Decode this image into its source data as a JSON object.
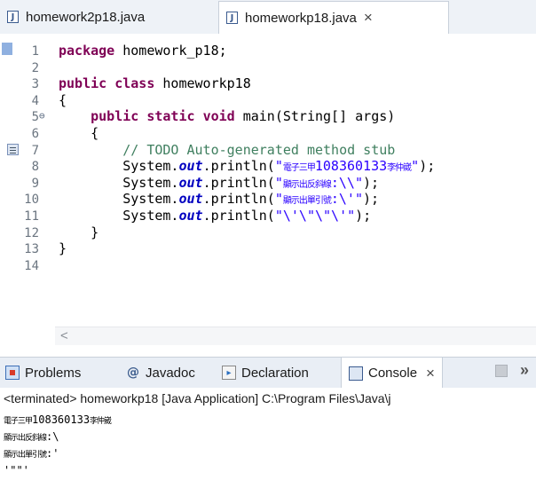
{
  "editor_tabs": [
    {
      "label": "homework2p18.java",
      "active": false
    },
    {
      "label": "homeworkp18.java",
      "active": true,
      "close": "×"
    }
  ],
  "code_lines": [
    {
      "num": "1",
      "segments": [
        {
          "t": "kw",
          "v": "package"
        },
        {
          "t": "pl",
          "v": " homework_p18;"
        }
      ]
    },
    {
      "num": "2",
      "segments": []
    },
    {
      "num": "3",
      "segments": [
        {
          "t": "kw",
          "v": "public"
        },
        {
          "t": "pl",
          "v": " "
        },
        {
          "t": "kw",
          "v": "class"
        },
        {
          "t": "pl",
          "v": " homeworkp18"
        }
      ]
    },
    {
      "num": "4",
      "segments": [
        {
          "t": "pl",
          "v": "{"
        }
      ]
    },
    {
      "num": "5",
      "fold": "⊖",
      "segments": [
        {
          "t": "pl",
          "v": "    "
        },
        {
          "t": "kw",
          "v": "public"
        },
        {
          "t": "pl",
          "v": " "
        },
        {
          "t": "kw",
          "v": "static"
        },
        {
          "t": "pl",
          "v": " "
        },
        {
          "t": "kw",
          "v": "void"
        },
        {
          "t": "pl",
          "v": " main(String[] args)"
        }
      ]
    },
    {
      "num": "6",
      "segments": [
        {
          "t": "pl",
          "v": "    {"
        }
      ]
    },
    {
      "num": "7",
      "task": true,
      "segments": [
        {
          "t": "pl",
          "v": "        "
        },
        {
          "t": "cm",
          "v": "// TODO Auto-generated method stub"
        }
      ]
    },
    {
      "num": "8",
      "segments": [
        {
          "t": "pl",
          "v": "        System."
        },
        {
          "t": "fld",
          "v": "out"
        },
        {
          "t": "pl",
          "v": ".println("
        },
        {
          "t": "st",
          "v": "\""
        },
        {
          "t": "stcjk",
          "v": "電子三甲"
        },
        {
          "t": "st",
          "v": "108360133"
        },
        {
          "t": "stcjk",
          "v": "李仲崴"
        },
        {
          "t": "st",
          "v": "\""
        },
        {
          "t": "pl",
          "v": ");"
        }
      ]
    },
    {
      "num": "9",
      "segments": [
        {
          "t": "pl",
          "v": "        System."
        },
        {
          "t": "fld",
          "v": "out"
        },
        {
          "t": "pl",
          "v": ".println("
        },
        {
          "t": "st",
          "v": "\""
        },
        {
          "t": "stcjk",
          "v": "顯示出反斜線"
        },
        {
          "t": "st",
          "v": ":\\\\\""
        },
        {
          "t": "pl",
          "v": ");"
        }
      ]
    },
    {
      "num": "10",
      "segments": [
        {
          "t": "pl",
          "v": "        System."
        },
        {
          "t": "fld",
          "v": "out"
        },
        {
          "t": "pl",
          "v": ".println("
        },
        {
          "t": "st",
          "v": "\""
        },
        {
          "t": "stcjk",
          "v": "顯示出單引號"
        },
        {
          "t": "st",
          "v": ":\\'\""
        },
        {
          "t": "pl",
          "v": ");"
        }
      ]
    },
    {
      "num": "11",
      "segments": [
        {
          "t": "pl",
          "v": "        System."
        },
        {
          "t": "fld",
          "v": "out"
        },
        {
          "t": "pl",
          "v": ".println("
        },
        {
          "t": "st",
          "v": "\"\\'\\\"\\\"\\'\""
        },
        {
          "t": "pl",
          "v": ");"
        }
      ]
    },
    {
      "num": "12",
      "segments": [
        {
          "t": "pl",
          "v": "    }"
        }
      ]
    },
    {
      "num": "13",
      "segments": [
        {
          "t": "pl",
          "v": "}"
        }
      ]
    },
    {
      "num": "14",
      "segments": []
    }
  ],
  "scroll_arrow": "<",
  "view_tabs": {
    "problems": "Problems",
    "javadoc": "Javadoc",
    "declaration": "Declaration",
    "console": "Console",
    "close": "×",
    "overflow": "»"
  },
  "console": {
    "terminated": "<terminated> homeworkp18 [Java Application] C:\\Program Files\\Java\\j",
    "output": [
      [
        {
          "t": "cjk",
          "v": "電子三甲"
        },
        {
          "t": "pl",
          "v": "108360133"
        },
        {
          "t": "cjk",
          "v": "李仲崴"
        }
      ],
      [
        {
          "t": "cjk",
          "v": "顯示出反斜線"
        },
        {
          "t": "pl",
          "v": ":\\"
        }
      ],
      [
        {
          "t": "cjk",
          "v": "顯示出單引號"
        },
        {
          "t": "pl",
          "v": ":'"
        }
      ],
      [
        {
          "t": "pl",
          "v": "'\"\"'"
        }
      ]
    ]
  },
  "colors": {
    "keyword": "#7f0055",
    "comment": "#3f7f5f",
    "string": "#2a00ff",
    "field": "#0000c0"
  }
}
